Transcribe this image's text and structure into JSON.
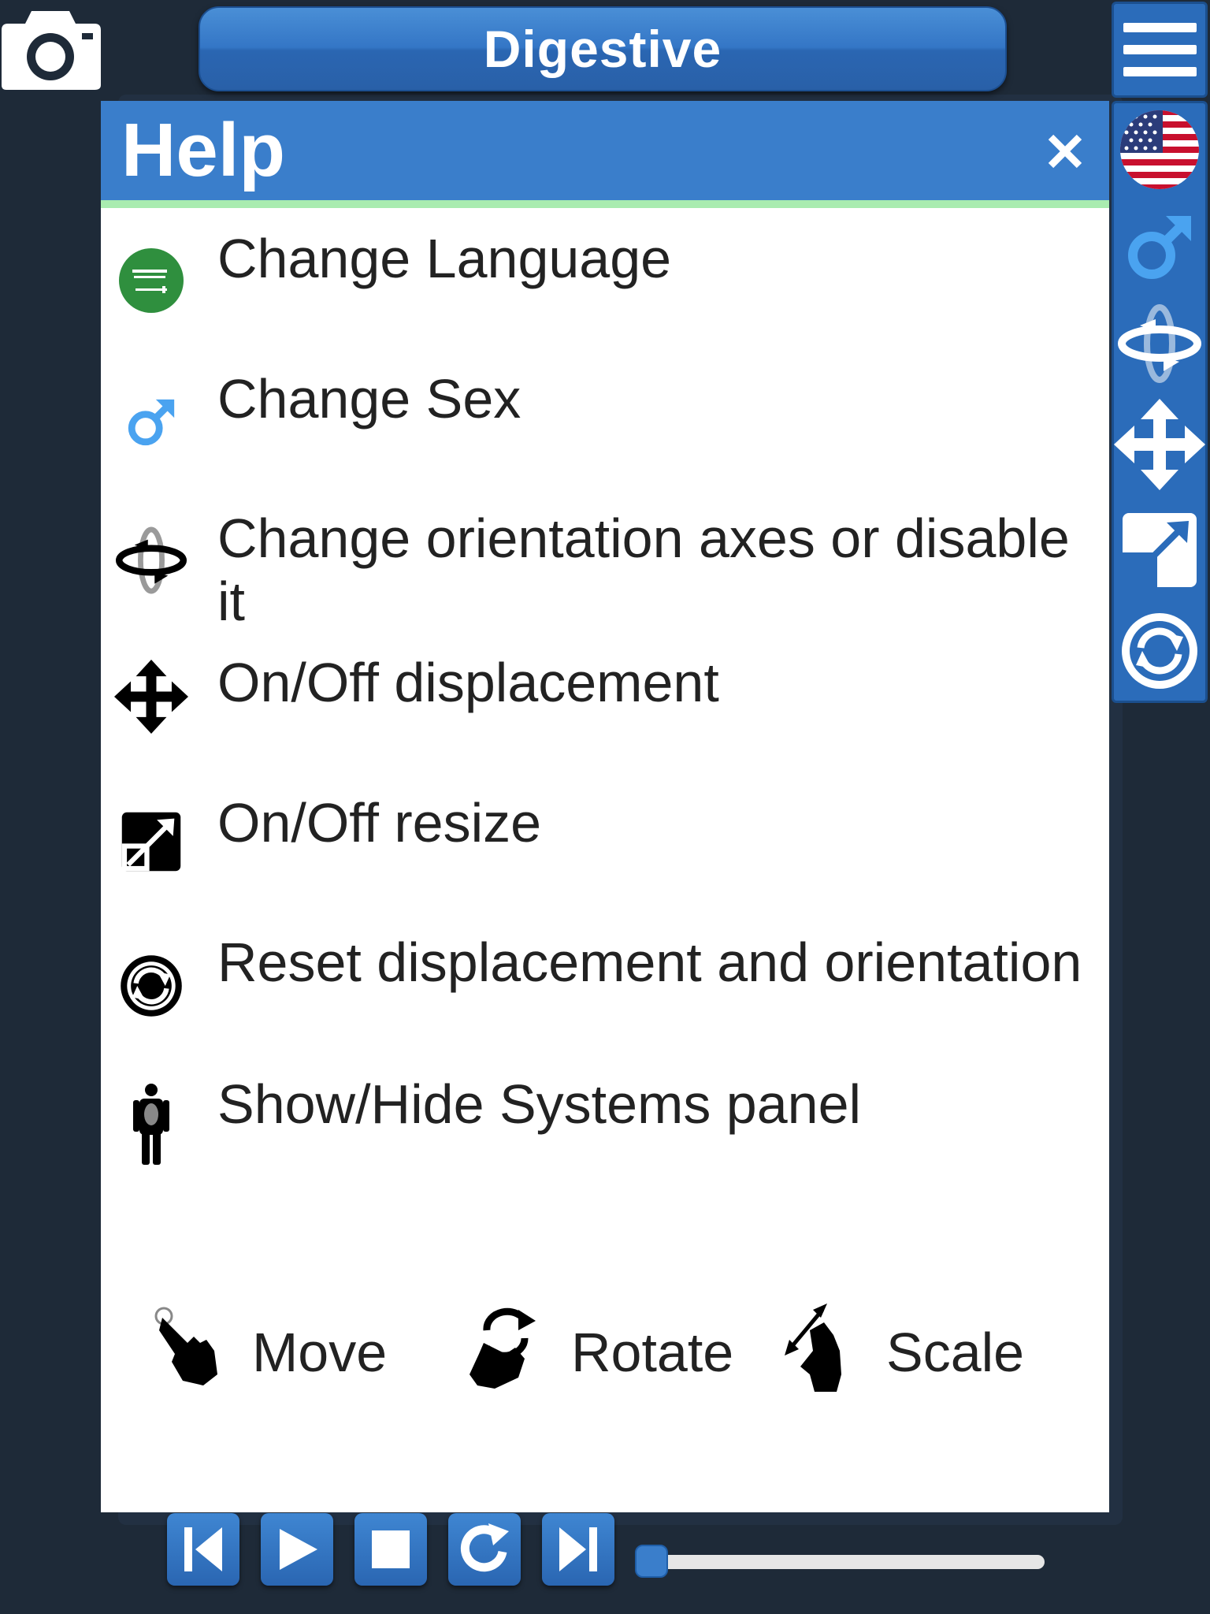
{
  "header": {
    "title": "Digestive"
  },
  "help": {
    "title": "Help",
    "items": [
      {
        "icon": "saudi-flag-icon",
        "label": "Change Language"
      },
      {
        "icon": "male-symbol-icon",
        "label": "Change Sex"
      },
      {
        "icon": "rotation-axes-icon",
        "label": "Change orientation axes or disable it"
      },
      {
        "icon": "move-arrows-icon",
        "label": "On/Off displacement"
      },
      {
        "icon": "resize-icon",
        "label": "On/Off resize"
      },
      {
        "icon": "reset-icon",
        "label": "Reset displacement and orientation"
      },
      {
        "icon": "body-systems-icon",
        "label": "Show/Hide Systems panel"
      }
    ],
    "gestures": [
      {
        "icon": "tap-hand-icon",
        "label": "Move"
      },
      {
        "icon": "rotate-hand-icon",
        "label": "Rotate"
      },
      {
        "icon": "pinch-hand-icon",
        "label": "Scale"
      }
    ]
  },
  "toolbar": [
    "us-flag-icon",
    "male-symbol-icon",
    "rotation-axes-icon",
    "move-arrows-icon",
    "resize-icon",
    "reset-icon"
  ],
  "playback": {
    "controls": [
      "skip-start-icon",
      "play-icon",
      "stop-icon",
      "replay-icon",
      "skip-end-icon"
    ],
    "progress": 0
  },
  "colors": {
    "accent": "#3a7ecb",
    "header_border": "#a9ecb0",
    "background": "#1e2a38"
  }
}
